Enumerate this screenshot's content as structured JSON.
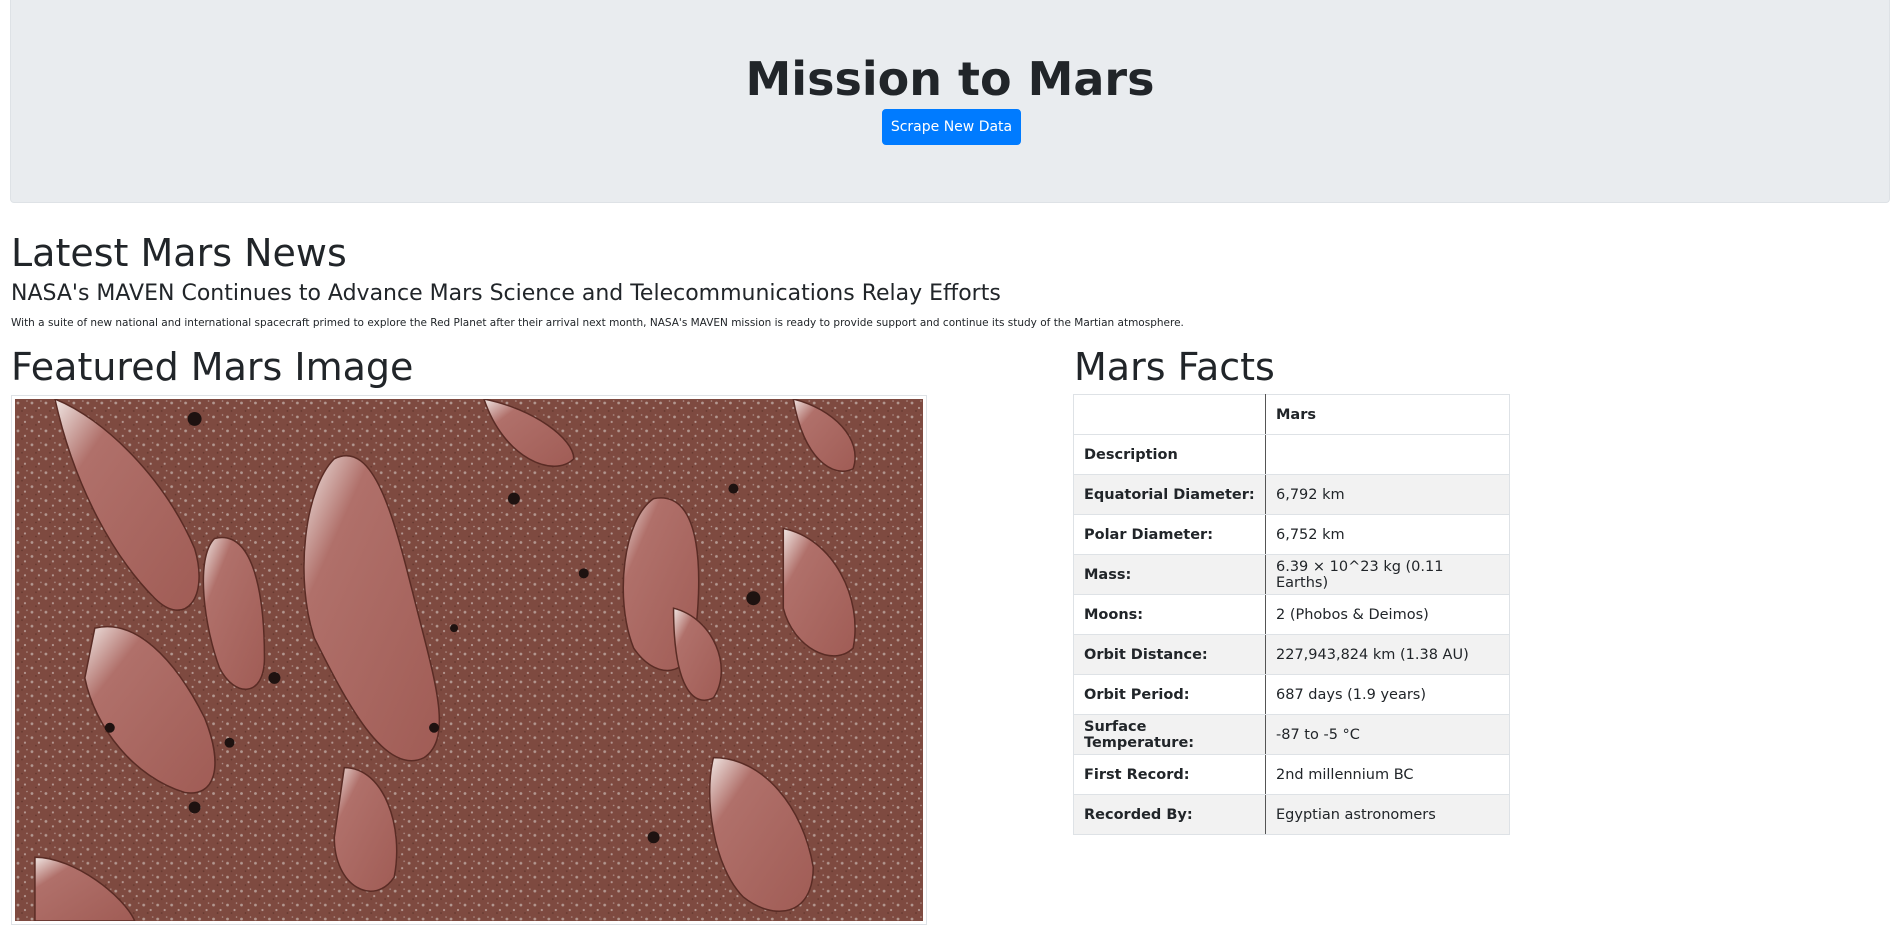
{
  "header": {
    "title": "Mission to Mars",
    "scrape_button": "Scrape New Data"
  },
  "news": {
    "heading": "Latest Mars News",
    "title": "NASA's MAVEN Continues to Advance Mars Science and Telecommunications Relay Efforts",
    "paragraph": "With a suite of new national and international spacecraft primed to explore the Red Planet after their arrival next month, NASA's MAVEN mission is ready to provide support and continue its study of the Martian atmosphere."
  },
  "featured": {
    "heading": "Featured Mars Image"
  },
  "facts": {
    "heading": "Mars Facts",
    "header_col1": "",
    "header_col2": "Mars",
    "rows": [
      {
        "label": "Description",
        "value": ""
      },
      {
        "label": "Equatorial Diameter:",
        "value": "6,792 km"
      },
      {
        "label": "Polar Diameter:",
        "value": "6,752 km"
      },
      {
        "label": "Mass:",
        "value": "6.39 × 10^23 kg (0.11 Earths)"
      },
      {
        "label": "Moons:",
        "value": "2 (Phobos & Deimos)"
      },
      {
        "label": "Orbit Distance:",
        "value": "227,943,824 km (1.38 AU)"
      },
      {
        "label": "Orbit Period:",
        "value": "687 days (1.9 years)"
      },
      {
        "label": "Surface Temperature:",
        "value": "-87 to -5 °C"
      },
      {
        "label": "First Record:",
        "value": "2nd millennium BC"
      },
      {
        "label": "Recorded By:",
        "value": "Egyptian astronomers"
      }
    ]
  },
  "colors": {
    "jumbotron_bg": "#e9ecef",
    "primary": "#007bff",
    "mars_surface": "#8a4f44"
  }
}
